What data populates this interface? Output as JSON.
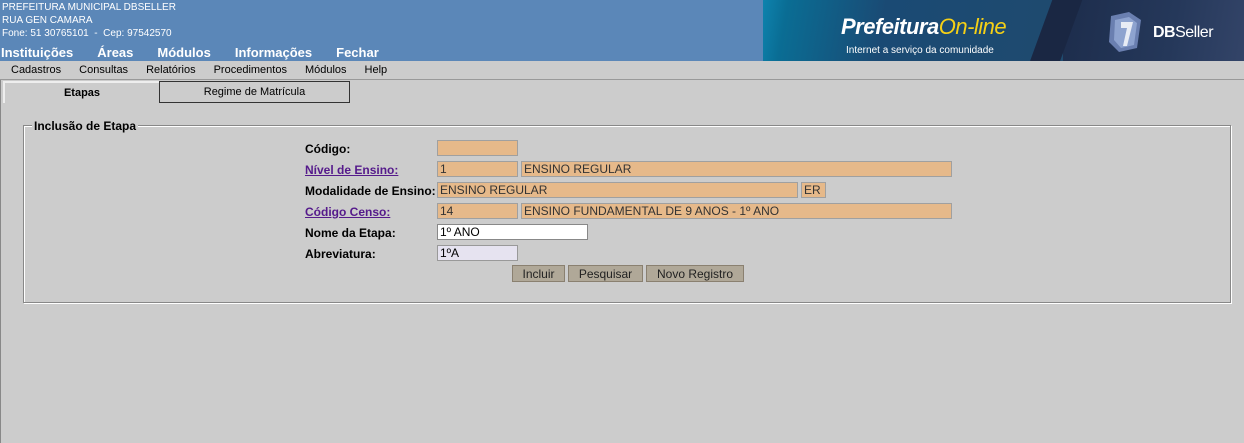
{
  "header": {
    "org_line1": "PREFEITURA MUNICIPAL DBSELLER",
    "org_line2": "RUA GEN CAMARA",
    "org_line3": "Fone: 51 30765101  -  Cep: 97542570",
    "nav": [
      "Instituições",
      "Áreas",
      "Módulos",
      "Informações",
      "Fechar"
    ],
    "banner_brand_main": "Prefeitura",
    "banner_brand_accent": "On-line",
    "banner_tagline": "Internet a serviço da comunidade",
    "dbseller_bold": "DB",
    "dbseller_light": "Seller"
  },
  "menubar": [
    "Cadastros",
    "Consultas",
    "Relatórios",
    "Procedimentos",
    "Módulos",
    "Help"
  ],
  "tabs": [
    {
      "label": "Etapas",
      "active": true
    },
    {
      "label": "Regime de Matrícula",
      "active": false
    }
  ],
  "form": {
    "legend": "Inclusão de Etapa",
    "codigo_label": "Código:",
    "codigo_value": "",
    "nivel_label": "Nível de Ensino:",
    "nivel_code": "1",
    "nivel_desc": "ENSINO REGULAR",
    "modalidade_label": "Modalidade de Ensino:",
    "modalidade_desc": "ENSINO REGULAR",
    "modalidade_abbr": "ER",
    "censo_label": "Código Censo:",
    "censo_code": "14",
    "censo_desc": "ENSINO FUNDAMENTAL DE 9 ANOS - 1º ANO",
    "nome_label": "Nome da Etapa:",
    "nome_value": "1º ANO",
    "abrev_label": "Abreviatura:",
    "abrev_value": "1ºA"
  },
  "buttons": {
    "incluir": "Incluir",
    "pesquisar": "Pesquisar",
    "novo": "Novo Registro"
  },
  "colors": {
    "header_bg": "#5b87b8",
    "readonly_field": "#e6b98a",
    "page_bg": "#cccccc"
  }
}
